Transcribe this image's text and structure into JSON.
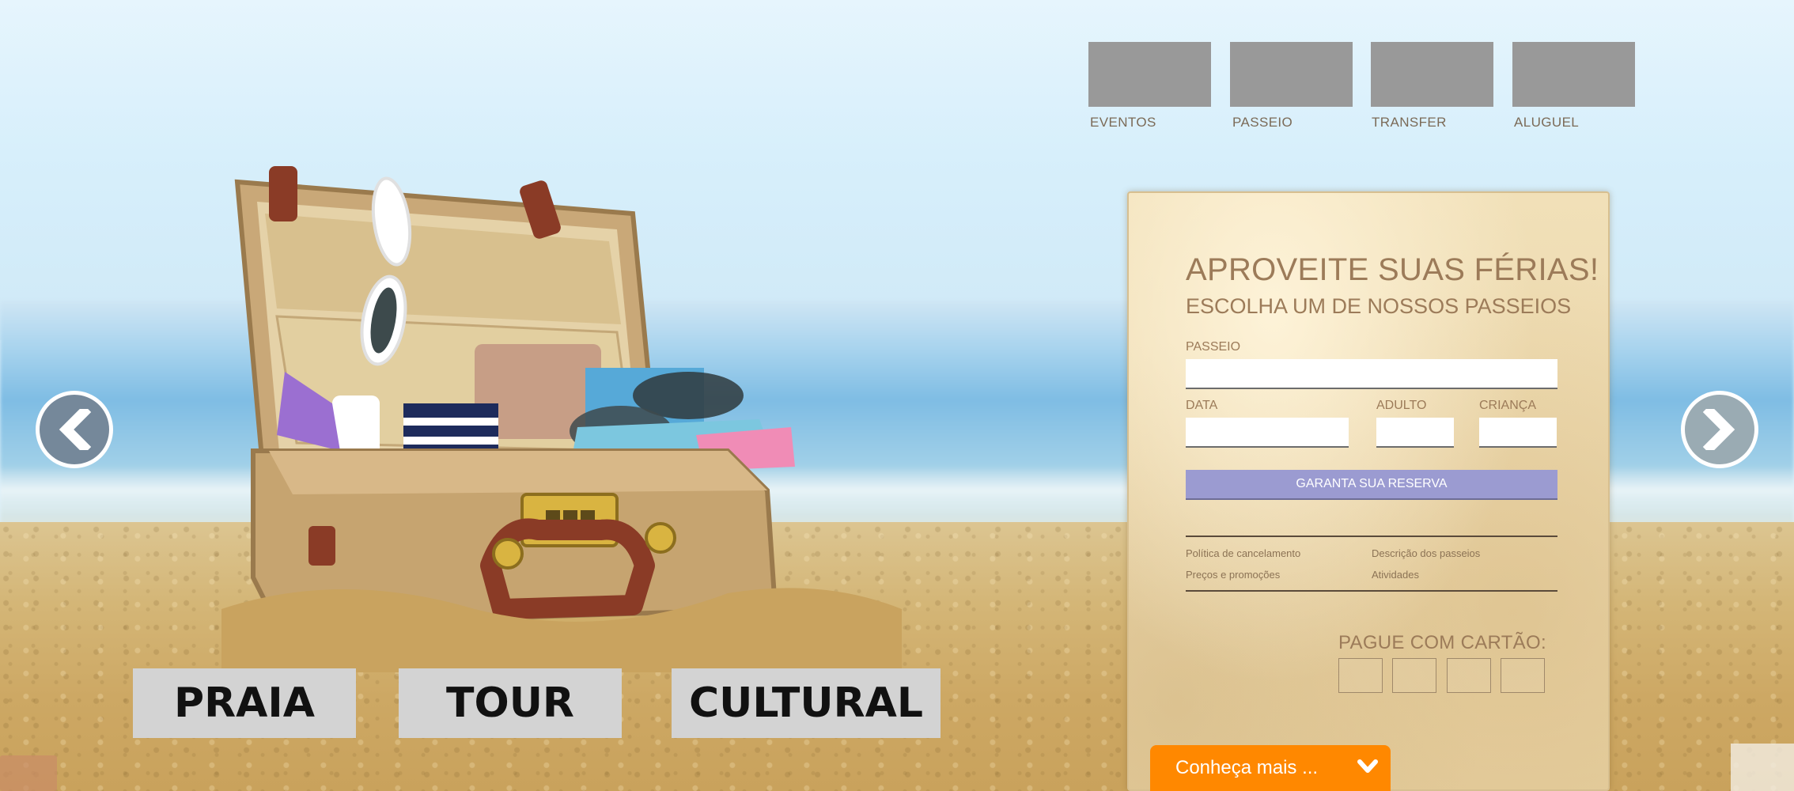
{
  "categories": [
    {
      "id": "eventos",
      "label": "EVENTOS"
    },
    {
      "id": "passeio",
      "label": "PASSEIO"
    },
    {
      "id": "transfer",
      "label": "TRANSFER"
    },
    {
      "id": "aluguel",
      "label": "ALUGUEL"
    }
  ],
  "slider": {
    "prev_icon": "chevron-left-icon",
    "next_icon": "chevron-right-icon"
  },
  "category_buttons": [
    {
      "id": "praia",
      "label": "PRAIA"
    },
    {
      "id": "tour",
      "label": "TOUR"
    },
    {
      "id": "cultural",
      "label": "CULTURAL"
    }
  ],
  "booking": {
    "title": "APROVEITE SUAS FÉRIAS!",
    "subtitle": "ESCOLHA UM DE NOSSOS PASSEIOS",
    "passeio_label": "PASSEIO",
    "passeio_value": "",
    "data_label": "DATA",
    "data_value": "",
    "adulto_label": "ADULTO",
    "adulto_value": "",
    "crianca_label": "CRIANÇA",
    "crianca_value": "",
    "reserve_label": "GARANTA SUA RESERVA",
    "links": [
      {
        "id": "politica",
        "label": "Política de cancelamento"
      },
      {
        "id": "descricao",
        "label": "Descrição dos passeios"
      },
      {
        "id": "precos",
        "label": "Preços e promoções"
      },
      {
        "id": "atividades",
        "label": "Atividades"
      }
    ],
    "pay_label": "PAGUE COM CARTÃO:"
  },
  "more": {
    "label": "Conheça mais ...",
    "icon": "chevron-down-icon"
  },
  "colors": {
    "accent_orange": "#ff8800",
    "reserve_button": "#9b9bd1",
    "panel_text": "#9c7b59",
    "tile_gray": "#999999"
  }
}
